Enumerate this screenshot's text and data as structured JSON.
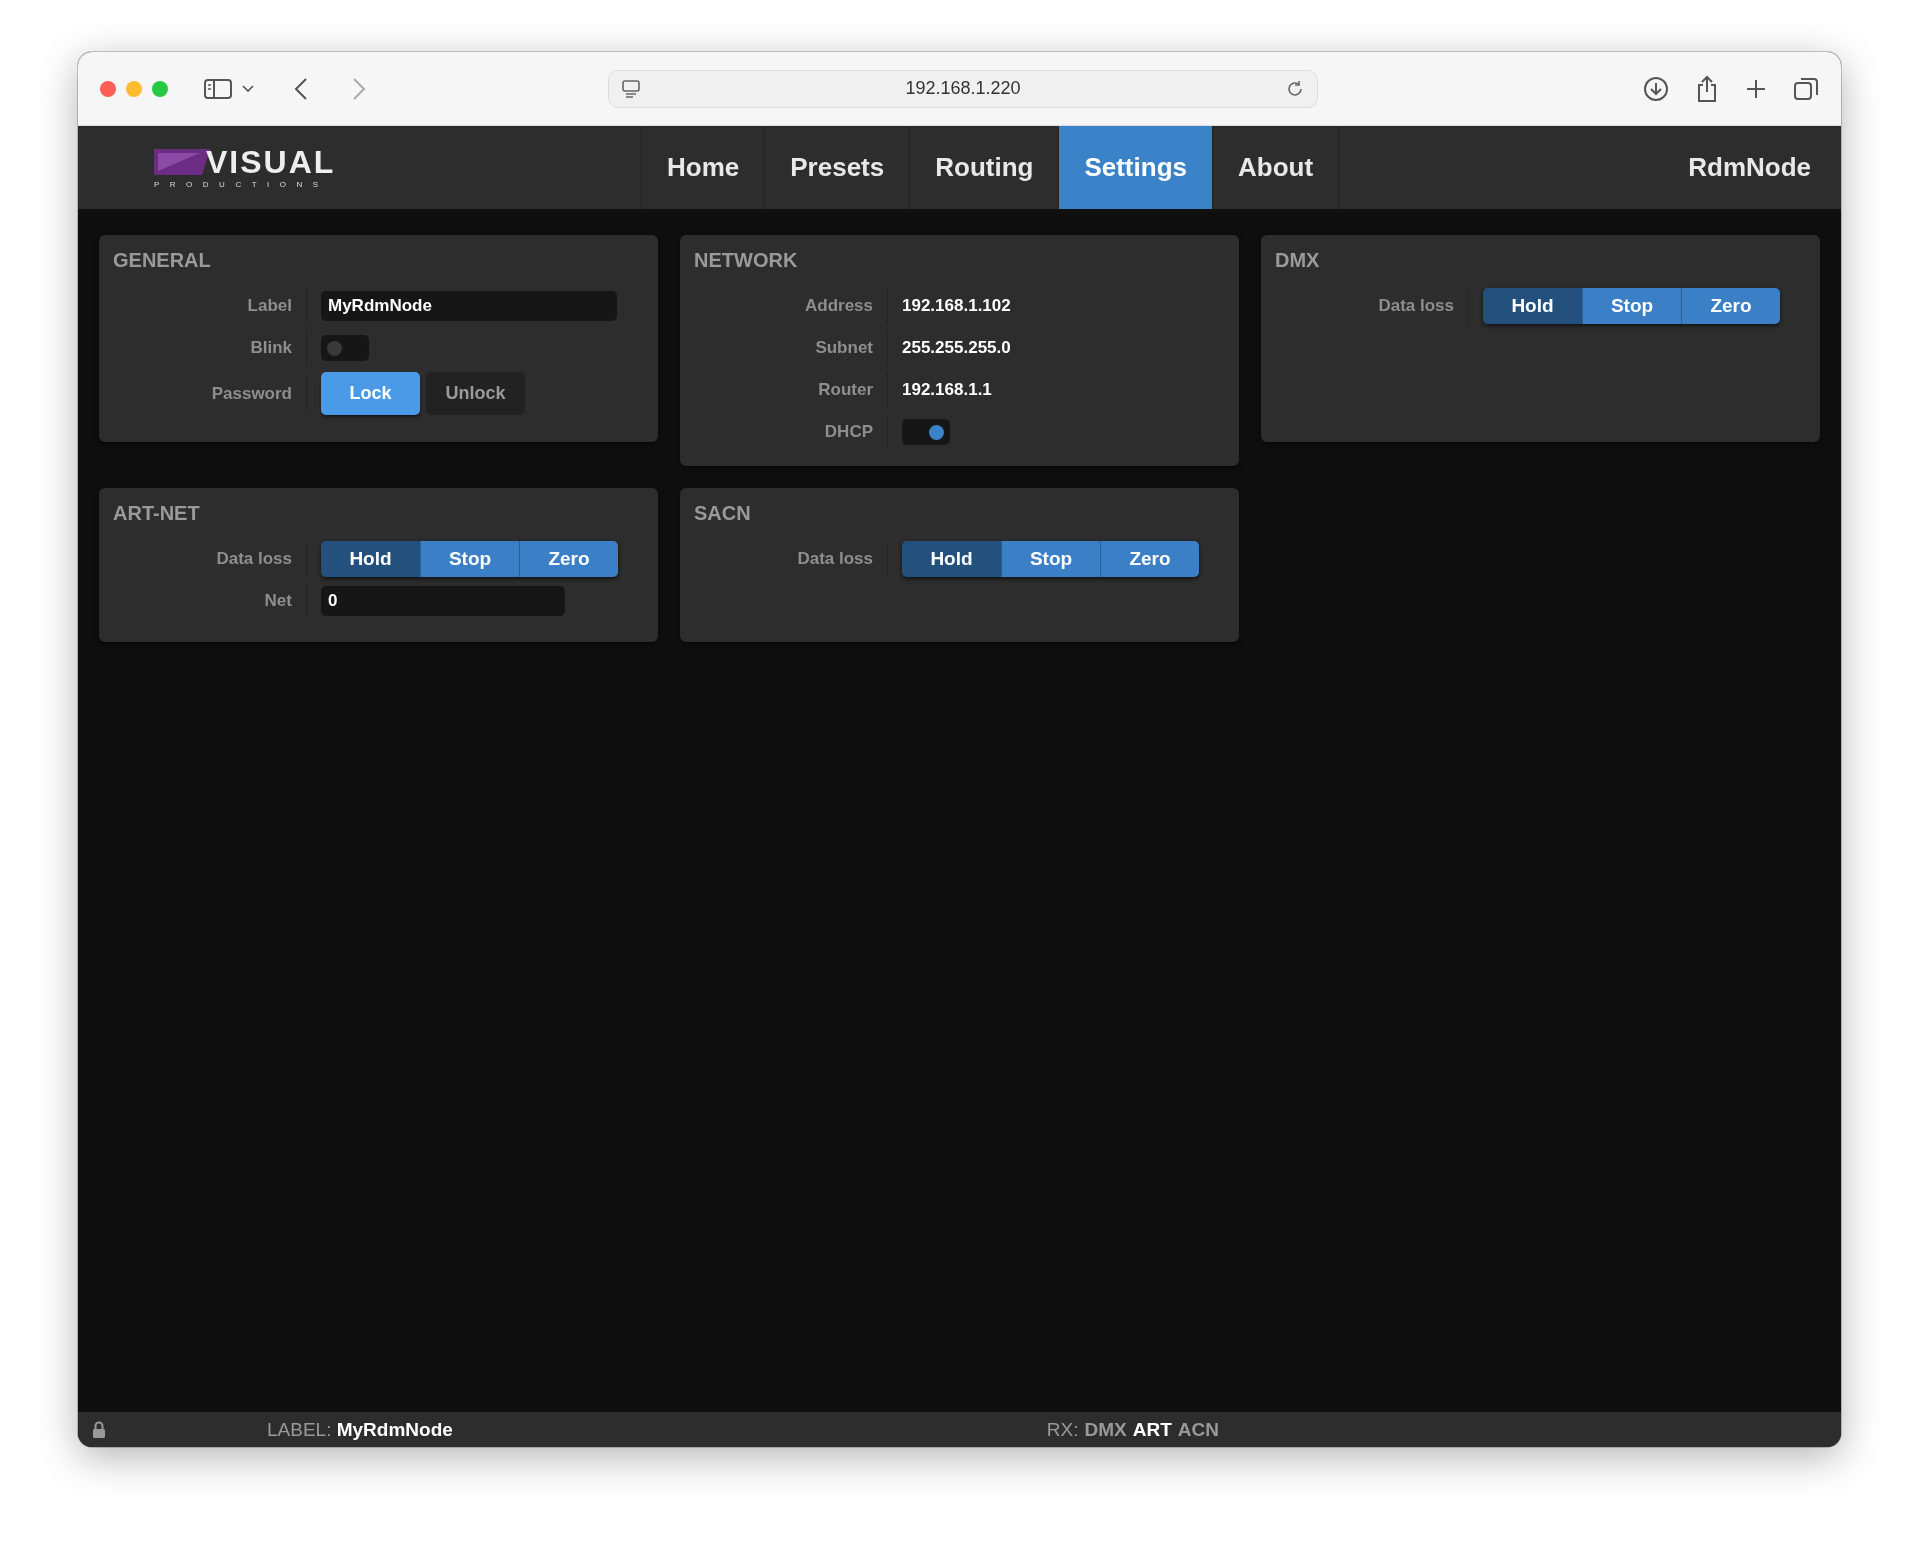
{
  "browser": {
    "address": "192.168.1.220"
  },
  "header": {
    "logo": {
      "wordmark": "VISUAL",
      "tagline": "PRODUCTIONS"
    },
    "nav": [
      {
        "label": "Home",
        "selected": false
      },
      {
        "label": "Presets",
        "selected": false
      },
      {
        "label": "Routing",
        "selected": false
      },
      {
        "label": "Settings",
        "selected": true
      },
      {
        "label": "About",
        "selected": false
      }
    ],
    "device_name": "RdmNode"
  },
  "panels": [
    {
      "title": "GENERAL",
      "rows": [
        {
          "kind": "field",
          "label": "Label",
          "value": "MyRdmNode"
        },
        {
          "kind": "toggle",
          "label": "Blink",
          "on": false
        },
        {
          "kind": "buttons",
          "label": "Password",
          "options": [
            {
              "label": "Lock",
              "selected": true
            },
            {
              "label": "Unlock",
              "selected": false
            }
          ]
        }
      ]
    },
    {
      "title": "NETWORK",
      "rows": [
        {
          "kind": "value",
          "label": "Address",
          "value": "192.168.1.102"
        },
        {
          "kind": "value",
          "label": "Subnet",
          "value": "255.255.255.0"
        },
        {
          "kind": "value",
          "label": "Router",
          "value": "192.168.1.1"
        },
        {
          "kind": "toggle",
          "label": "DHCP",
          "on": true
        }
      ]
    },
    {
      "title": "DMX",
      "rows": [
        {
          "kind": "segmented",
          "label": "Data loss",
          "options": [
            {
              "label": "Hold",
              "selected": true
            },
            {
              "label": "Stop",
              "selected": false
            },
            {
              "label": "Zero",
              "selected": false
            }
          ]
        }
      ]
    },
    {
      "title": "ART-NET",
      "rows": [
        {
          "kind": "segmented",
          "label": "Data loss",
          "options": [
            {
              "label": "Hold",
              "selected": true
            },
            {
              "label": "Stop",
              "selected": false
            },
            {
              "label": "Zero",
              "selected": false
            }
          ]
        },
        {
          "kind": "field",
          "label": "Net",
          "value": "0"
        }
      ]
    },
    {
      "title": "SACN",
      "rows": [
        {
          "kind": "segmented",
          "label": "Data loss",
          "options": [
            {
              "label": "Hold",
              "selected": true
            },
            {
              "label": "Stop",
              "selected": false
            },
            {
              "label": "Zero",
              "selected": false
            }
          ]
        }
      ]
    }
  ],
  "status_bar": {
    "locked": true,
    "label_caption": "LABEL:",
    "label_value": "MyRdmNode",
    "rx_caption": "RX:",
    "rx": [
      {
        "label": "DMX",
        "active": false
      },
      {
        "label": "ART",
        "active": true
      },
      {
        "label": "ACN",
        "active": false
      }
    ]
  }
}
